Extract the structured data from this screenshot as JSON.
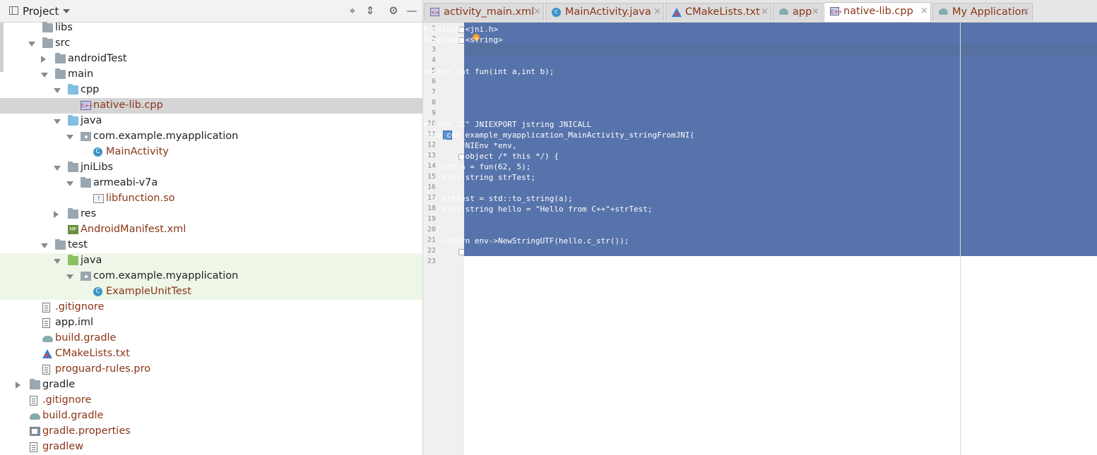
{
  "project": {
    "title": "Project",
    "tree": [
      {
        "label": "libs",
        "icon": "folder-icon",
        "indent": 1
      },
      {
        "label": "src",
        "icon": "folder-icon",
        "indent": 1,
        "expand": "open"
      },
      {
        "label": "androidTest",
        "icon": "folder-icon",
        "indent": 2,
        "expand": "closed"
      },
      {
        "label": "main",
        "icon": "folder-icon",
        "indent": 2,
        "expand": "open"
      },
      {
        "label": "cpp",
        "icon": "source-folder-icon",
        "indent": 3,
        "expand": "open"
      },
      {
        "label": "native-lib.cpp",
        "icon": "cpp-file-icon",
        "indent": 4,
        "modified": true,
        "selected": true
      },
      {
        "label": "java",
        "icon": "source-folder-icon",
        "indent": 3,
        "expand": "open"
      },
      {
        "label": "com.example.myapplication",
        "icon": "package-icon",
        "indent": 4,
        "expand": "open"
      },
      {
        "label": "MainActivity",
        "icon": "class-icon",
        "indent": 5,
        "modified": true
      },
      {
        "label": "jniLibs",
        "icon": "folder-icon",
        "indent": 3,
        "expand": "open"
      },
      {
        "label": "armeabi-v7a",
        "icon": "folder-icon",
        "indent": 4,
        "expand": "open"
      },
      {
        "label": "libfunction.so",
        "icon": "so-file-icon",
        "indent": 5,
        "modified": true
      },
      {
        "label": "res",
        "icon": "resources-folder-icon",
        "indent": 3,
        "expand": "closed"
      },
      {
        "label": "AndroidManifest.xml",
        "icon": "manifest-file-icon",
        "indent": 3,
        "modified": true
      },
      {
        "label": "test",
        "icon": "folder-icon",
        "indent": 2,
        "expand": "open"
      },
      {
        "label": "java",
        "icon": "test-folder-icon",
        "indent": 3,
        "expand": "open",
        "test": true
      },
      {
        "label": "com.example.myapplication",
        "icon": "package-icon",
        "indent": 4,
        "expand": "open",
        "test": true
      },
      {
        "label": "ExampleUnitTest",
        "icon": "test-class-icon",
        "indent": 5,
        "modified": true,
        "test": true
      },
      {
        "label": ".gitignore",
        "icon": "text-file-icon",
        "indent": 1,
        "modified": true
      },
      {
        "label": "app.iml",
        "icon": "iml-file-icon",
        "indent": 1
      },
      {
        "label": "build.gradle",
        "icon": "gradle-file-icon",
        "indent": 1,
        "modified": true
      },
      {
        "label": "CMakeLists.txt",
        "icon": "cmake-file-icon",
        "indent": 1,
        "modified": true
      },
      {
        "label": "proguard-rules.pro",
        "icon": "text-file-icon",
        "indent": 1,
        "modified": true
      },
      {
        "label": "gradle",
        "icon": "folder-icon",
        "indent": 0,
        "expand": "closed"
      },
      {
        "label": ".gitignore",
        "icon": "text-file-icon",
        "indent": 0,
        "modified": true
      },
      {
        "label": "build.gradle",
        "icon": "gradle-file-icon",
        "indent": 0,
        "modified": true
      },
      {
        "label": "gradle.properties",
        "icon": "properties-file-icon",
        "indent": 0,
        "modified": true
      },
      {
        "label": "gradlew",
        "icon": "text-file-icon",
        "indent": 0,
        "modified": true
      }
    ]
  },
  "tabs": [
    {
      "label": "activity_main.xml",
      "icon": "layout-xml-icon",
      "active": false
    },
    {
      "label": "MainActivity.java",
      "icon": "class-icon",
      "active": false
    },
    {
      "label": "CMakeLists.txt",
      "icon": "cmake-file-icon",
      "active": false
    },
    {
      "label": "app",
      "icon": "gradle-file-icon",
      "active": false
    },
    {
      "label": "native-lib.cpp",
      "icon": "cpp-file-icon",
      "active": true
    },
    {
      "label": "My Application",
      "icon": "gradle-file-icon",
      "active": false
    }
  ],
  "editor": {
    "lines": [
      "#include <jni.h>",
      "#include <string>",
      "",
      "",
      "extern int fun(int a,int b);",
      "",
      "",
      "",
      "",
      "extern \"C\" JNIEXPORT jstring JNICALL",
      "Java_com_example_myapplication_MainActivity_stringFromJNI(",
      "        JNIEnv *env,",
      "        jobject /* this */) {",
      "    int a = fun(62, 5);",
      "    std::string strTest;",
      "",
      "    strTest = std::to_string(a);",
      "    std::string hello = \"Hello from C++\"+strTest;",
      "",
      "",
      "    return env->NewStringUTF(hello.c_str());",
      "}",
      ""
    ],
    "line_numbers": [
      "1",
      "2",
      "3",
      "4",
      "5",
      "6",
      "7",
      "8",
      "9",
      "10",
      "11",
      "12",
      "13",
      "14",
      "15",
      "16",
      "17",
      "18",
      "19",
      "20",
      "21",
      "22",
      "23"
    ]
  },
  "colors": {
    "selection": "#5773ab",
    "modified_file_text": "#8a3416"
  }
}
